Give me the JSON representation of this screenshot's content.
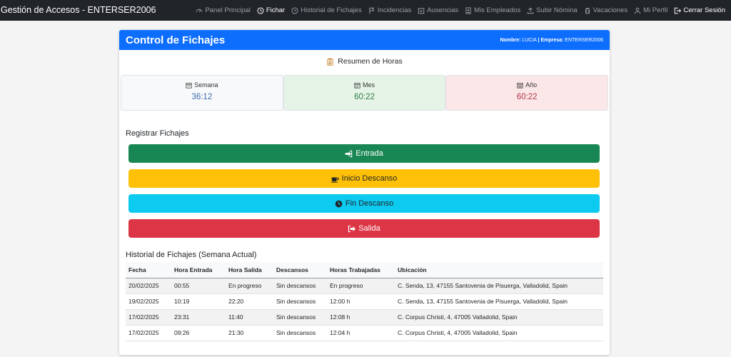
{
  "nav": {
    "brand": "Gestión de Accesos - ENTERSER2006",
    "items": [
      {
        "label": "Panel Principal",
        "icon": "speedometer-icon"
      },
      {
        "label": "Fichar",
        "icon": "clock-icon"
      },
      {
        "label": "Historial de Fichajes",
        "icon": "history-icon"
      },
      {
        "label": "Incidencias",
        "icon": "flag-icon"
      },
      {
        "label": "Ausencias",
        "icon": "calendar-x-icon"
      },
      {
        "label": "Mis Empleados",
        "icon": "person-badge-icon"
      },
      {
        "label": "Subir Nómina",
        "icon": "upload-icon"
      },
      {
        "label": "Vacaciones",
        "icon": "luggage-icon"
      },
      {
        "label": "Mi Perfil",
        "icon": "person-icon"
      },
      {
        "label": "Cerrar Sesión",
        "icon": "logout-icon"
      }
    ]
  },
  "card": {
    "title": "Control de Fichajes",
    "name_label": "Nombre:",
    "name_value": "LUCIA",
    "separator": "|",
    "company_label": "Empresa:",
    "company_value": "ENTERSER2006"
  },
  "summary": {
    "title": "Resumen de Horas",
    "week_label": "Semana",
    "week_value": "36:12",
    "month_label": "Mes",
    "month_value": "60:22",
    "year_label": "Año",
    "year_value": "60:22"
  },
  "register": {
    "title": "Registrar Fichajes",
    "entrada": "Entrada",
    "inicio_descanso": "Inicio Descanso",
    "fin_descanso": "Fin Descanso",
    "salida": "Salida"
  },
  "history": {
    "title": "Historial de Fichajes (Semana Actual)",
    "columns": [
      "Fecha",
      "Hora Entrada",
      "Hora Salida",
      "Descansos",
      "Horas Trabajadas",
      "Ubicación"
    ],
    "rows": [
      [
        "20/02/2025",
        "00:55",
        "En progreso",
        "Sin descansos",
        "En progreso",
        "C. Senda, 13, 47155 Santovenia de Pisuerga, Valladolid, Spain"
      ],
      [
        "19/02/2025",
        "10:19",
        "22:20",
        "Sin descansos",
        "12:00 h",
        "C. Senda, 13, 47155 Santovenia de Pisuerga, Valladolid, Spain"
      ],
      [
        "17/02/2025",
        "23:31",
        "11:40",
        "Sin descansos",
        "12:08 h",
        "C. Corpus Christi, 4, 47005 Valladolid, Spain"
      ],
      [
        "17/02/2025",
        "09:26",
        "21:30",
        "Sin descansos",
        "12:04 h",
        "C. Corpus Christi, 4, 47005 Valladolid, Spain"
      ]
    ]
  },
  "colors": {
    "primary": "#0d6efd",
    "success": "#198754",
    "warning": "#ffc107",
    "info": "#0dcaf0",
    "danger": "#dc3545",
    "navbar": "#212529"
  }
}
